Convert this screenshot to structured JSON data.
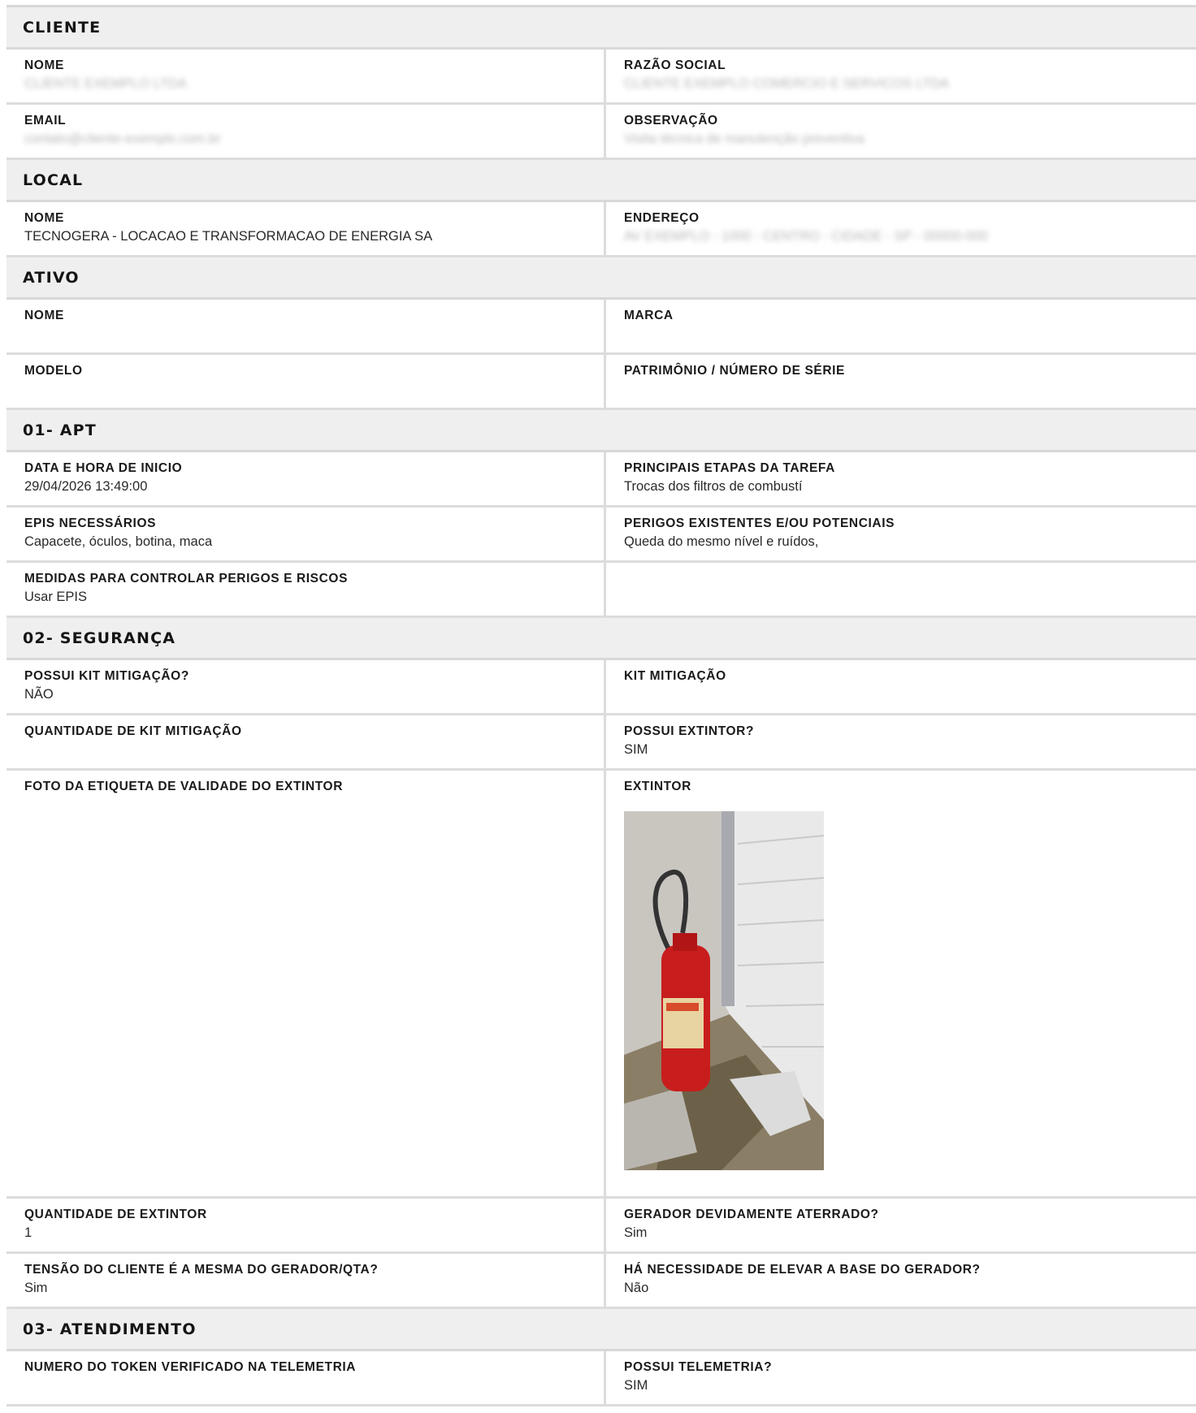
{
  "sections": [
    {
      "title": "CLIENTE",
      "rows": [
        [
          {
            "label": "NOME",
            "value": "CLIENTE EXEMPLO LTDA",
            "blurred": true
          },
          {
            "label": "RAZÃO SOCIAL",
            "value": "CLIENTE EXEMPLO COMERCIO E SERVICOS LTDA",
            "blurred": true
          }
        ],
        [
          {
            "label": "EMAIL",
            "value": "contato@cliente-exemplo.com.br",
            "blurred": true
          },
          {
            "label": "OBSERVAÇÃO",
            "value": "Visita técnica de manutenção preventiva",
            "blurred": true
          }
        ]
      ]
    },
    {
      "title": "LOCAL",
      "rows": [
        [
          {
            "label": "NOME",
            "value": "TECNOGERA - LOCACAO E TRANSFORMACAO DE ENERGIA SA"
          },
          {
            "label": "ENDEREÇO",
            "value": "AV EXEMPLO - 1000 - CENTRO - CIDADE - SP - 00000-000",
            "blurred": true
          }
        ]
      ]
    },
    {
      "title": "ATIVO",
      "rows": [
        [
          {
            "label": "NOME",
            "value": ""
          },
          {
            "label": "MARCA",
            "value": ""
          }
        ],
        [
          {
            "label": "MODELO",
            "value": ""
          },
          {
            "label": "PATRIMÔNIO / NÚMERO DE SÉRIE",
            "value": ""
          }
        ]
      ]
    },
    {
      "title": "01- APT",
      "rows": [
        [
          {
            "label": "DATA E HORA DE INICIO",
            "value": "29/04/2026 13:49:00"
          },
          {
            "label": "PRINCIPAIS ETAPAS DA TAREFA",
            "value": "Trocas dos filtros de combustí"
          }
        ],
        [
          {
            "label": "EPIS NECESSÁRIOS",
            "value": "Capacete, óculos, botina, maca"
          },
          {
            "label": "PERIGOS EXISTENTES E/OU POTENCIAIS",
            "value": "Queda do mesmo nível e ruídos,"
          }
        ],
        [
          {
            "label": "MEDIDAS PARA CONTROLAR PERIGOS E RISCOS",
            "value": "Usar EPIS"
          },
          {
            "label": "",
            "value": ""
          }
        ]
      ]
    },
    {
      "title": "02- SEGURANÇA",
      "rows": [
        [
          {
            "label": "POSSUI KIT MITIGAÇÃO?",
            "value": "NÃO"
          },
          {
            "label": "KIT MITIGAÇÃO",
            "value": ""
          }
        ],
        [
          {
            "label": "QUANTIDADE DE KIT MITIGAÇÃO",
            "value": ""
          },
          {
            "label": "POSSUI EXTINTOR?",
            "value": "SIM"
          }
        ],
        [
          {
            "label": "FOTO DA ETIQUETA DE VALIDADE DO EXTINTOR",
            "value": ""
          },
          {
            "label": "EXTINTOR",
            "value": "",
            "photo": "fire-extinguisher-photo"
          }
        ],
        [
          {
            "label": "QUANTIDADE DE EXTINTOR",
            "value": "1"
          },
          {
            "label": "GERADOR DEVIDAMENTE ATERRADO?",
            "value": "Sim"
          }
        ],
        [
          {
            "label": "TENSÃO DO CLIENTE É A MESMA DO GERADOR/QTA?",
            "value": "Sim"
          },
          {
            "label": "HÁ NECESSIDADE DE ELEVAR A BASE DO GERADOR?",
            "value": "Não"
          }
        ]
      ]
    },
    {
      "title": "03- ATENDIMENTO",
      "rows": [
        [
          {
            "label": "NUMERO DO TOKEN VERIFICADO NA TELEMETRIA",
            "value": ""
          },
          {
            "label": "POSSUI TELEMETRIA?",
            "value": "SIM"
          }
        ]
      ]
    }
  ]
}
